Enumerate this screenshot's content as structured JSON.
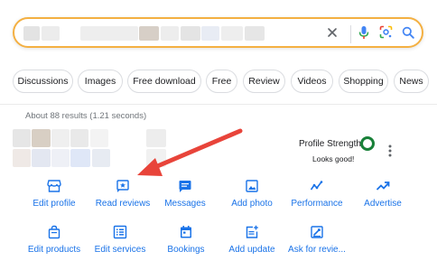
{
  "search": {
    "clear_icon": "close-icon",
    "voice_icon": "mic-icon",
    "lens_icon": "lens-icon",
    "search_icon": "search-icon",
    "border_color": "#f4b042",
    "query_redacted": true
  },
  "chips": [
    {
      "label": "Discussions"
    },
    {
      "label": "Images"
    },
    {
      "label": "Free download"
    },
    {
      "label": "Free"
    },
    {
      "label": "Review"
    },
    {
      "label": "Videos"
    },
    {
      "label": "Shopping"
    },
    {
      "label": "News"
    }
  ],
  "results": {
    "count_text": "About 88 results (1.21 seconds)"
  },
  "profile": {
    "strength_label": "Profile Strength",
    "strength_status": "Looks good!",
    "strength_color": "#188038",
    "name_redacted": true
  },
  "actions_row1": [
    {
      "label": "Edit profile",
      "icon": "storefront-icon"
    },
    {
      "label": "Read reviews",
      "icon": "review-star-icon"
    },
    {
      "label": "Messages",
      "icon": "message-icon"
    },
    {
      "label": "Add photo",
      "icon": "photo-icon"
    },
    {
      "label": "Performance",
      "icon": "performance-icon"
    },
    {
      "label": "Advertise",
      "icon": "trending-icon"
    }
  ],
  "actions_row2": [
    {
      "label": "Edit products",
      "icon": "shopping-bag-icon"
    },
    {
      "label": "Edit services",
      "icon": "list-icon"
    },
    {
      "label": "Bookings",
      "icon": "calendar-icon"
    },
    {
      "label": "Add update",
      "icon": "post-add-icon"
    },
    {
      "label": "Ask for revie...",
      "icon": "ask-review-icon"
    }
  ],
  "colors": {
    "accent": "#1a73e8",
    "arrow": "#e8443a"
  }
}
